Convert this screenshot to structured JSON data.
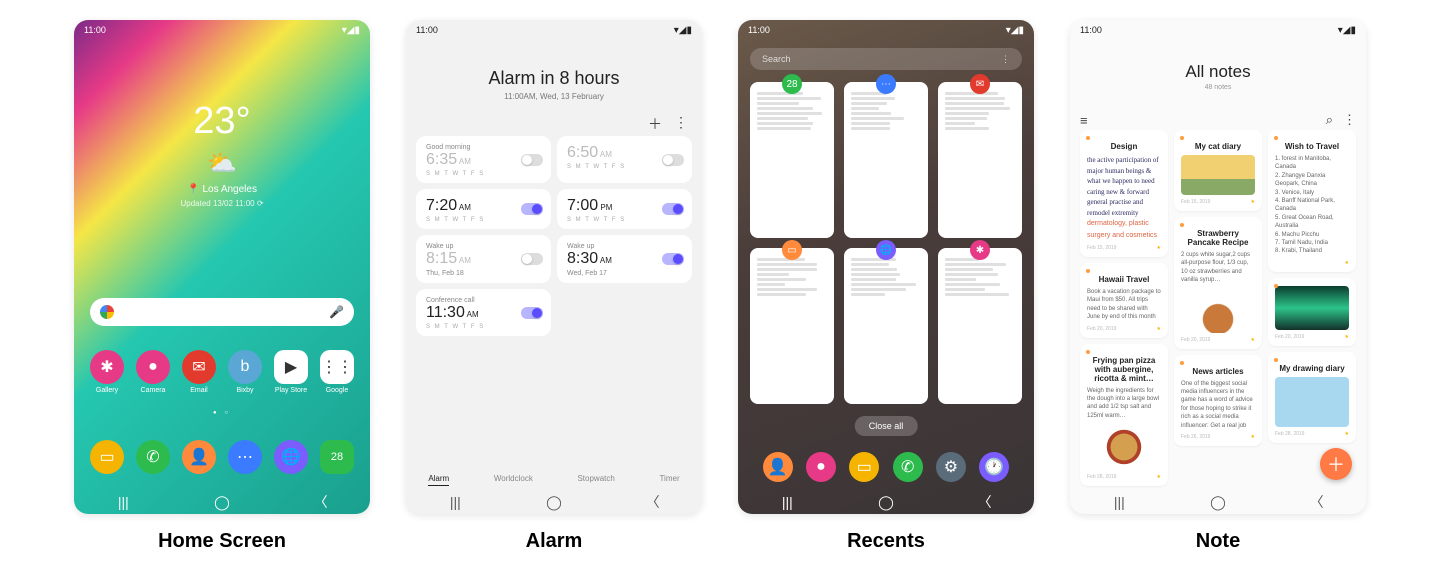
{
  "captions": {
    "home": "Home Screen",
    "alarm": "Alarm",
    "recents": "Recents",
    "note": "Note"
  },
  "status_time": "11:00",
  "home": {
    "temp": "23°",
    "location": "Los Angeles",
    "updated": "Updated 13/02 11:00 ⟳",
    "apps": [
      {
        "label": "Gallery",
        "bg": "#e73a86",
        "glyph": "✱"
      },
      {
        "label": "Camera",
        "bg": "#e73a86",
        "glyph": "●"
      },
      {
        "label": "Email",
        "bg": "#e23b2e",
        "glyph": "✉"
      },
      {
        "label": "Bixby",
        "bg": "#5aa7d6",
        "glyph": "b"
      },
      {
        "label": "Play Store",
        "bg": "#fff",
        "glyph": "▶"
      },
      {
        "label": "Google",
        "bg": "#fff",
        "glyph": "⋮⋮"
      }
    ],
    "dock": [
      {
        "bg": "#f5b400",
        "glyph": "▭"
      },
      {
        "bg": "#2dbb4e",
        "glyph": "✆"
      },
      {
        "bg": "#ff8a3c",
        "glyph": "👤"
      },
      {
        "bg": "#3a7bff",
        "glyph": "⋯"
      },
      {
        "bg": "#7a5cff",
        "glyph": "🌐"
      },
      {
        "bg": "#2dbb4e",
        "glyph": "28"
      }
    ]
  },
  "alarm": {
    "title": "Alarm in 8 hours",
    "subtitle": "11:00AM, Wed, 13 February",
    "days": "S M T W T F S",
    "tabs": [
      "Alarm",
      "Worldclock",
      "Stopwatch",
      "Timer"
    ],
    "cards": [
      {
        "label": "Good morning",
        "time": "6:35",
        "ampm": "AM",
        "mode": "days",
        "on": false
      },
      {
        "label": "",
        "time": "6:50",
        "ampm": "AM",
        "mode": "days",
        "on": false
      },
      {
        "label": "",
        "time": "7:20",
        "ampm": "AM",
        "mode": "days",
        "on": true
      },
      {
        "label": "",
        "time": "7:00",
        "ampm": "PM",
        "mode": "days",
        "on": true
      },
      {
        "label": "Wake up",
        "time": "8:15",
        "ampm": "AM",
        "mode": "date",
        "date": "Thu, Feb 18",
        "on": false
      },
      {
        "label": "Wake up",
        "time": "8:30",
        "ampm": "AM",
        "mode": "date",
        "date": "Wed, Feb 17",
        "on": true
      },
      {
        "label": "Conference call",
        "time": "11:30",
        "ampm": "AM",
        "mode": "days",
        "on": true
      }
    ]
  },
  "recents": {
    "search": "Search",
    "close_all": "Close all",
    "cards": [
      {
        "bg": "#2dbb4e",
        "glyph": "28"
      },
      {
        "bg": "#3a7bff",
        "glyph": "⋯"
      },
      {
        "bg": "#e23b2e",
        "glyph": "✉"
      },
      {
        "bg": "#ff8a3c",
        "glyph": "▭"
      },
      {
        "bg": "#7a5cff",
        "glyph": "🌐"
      },
      {
        "bg": "#e73a86",
        "glyph": "✱"
      }
    ],
    "dock": [
      {
        "bg": "#ff8a3c",
        "glyph": "👤"
      },
      {
        "bg": "#e73a86",
        "glyph": "●"
      },
      {
        "bg": "#f5b400",
        "glyph": "▭"
      },
      {
        "bg": "#2dbb4e",
        "glyph": "✆"
      },
      {
        "bg": "#5a6b7a",
        "glyph": "⚙"
      },
      {
        "bg": "#7a5cff",
        "glyph": "🕐"
      }
    ]
  },
  "note": {
    "title": "All notes",
    "subtitle": "48 notes",
    "col1": [
      {
        "title": "Design",
        "type": "hand",
        "body": "the active participation of major human beings & what we happen to need caring new & forward general practise and remodel extremity",
        "red": "dermatology, plastic surgery and cosmetics",
        "date": "Feb 15, 2019"
      },
      {
        "title": "Hawaii Travel",
        "type": "text",
        "body": "Book a vacation  package to Maui from $50. All trips need to be shared with June by end of this month",
        "date": "Feb 20, 2019"
      },
      {
        "title": "Frying pan pizza with aubergine, ricotta & mint…",
        "type": "pizza",
        "body": "Weigh the ingredients for the dough into a large bowl and add 1/2 tsp salt and 125ml warm…",
        "date": "Feb 28, 2019"
      }
    ],
    "col2": [
      {
        "title": "My cat diary",
        "type": "cat",
        "date": "Feb 15, 2019"
      },
      {
        "title": "Strawberry Pancake Recipe",
        "type": "pancake",
        "body": "2 cups white sugar,2 cups all-purpose flour, 1/3 cup, 10 oz strawberries and vanilla syrup…",
        "date": "Feb 20, 2019"
      },
      {
        "title": "News articles",
        "type": "text",
        "body": "One of the biggest social media influencers in the game has a word of advice for those hoping to strike it rich as a social media influencer: Get a real job",
        "date": "Feb 26, 2019"
      }
    ],
    "col3": [
      {
        "title": "Wish to Travel",
        "type": "list",
        "body": "1. forest in Manitoba, Canada\n2. Zhangye Danxia Geopark, China\n3. Venice, Italy\n4. Banff National Park, Canada\n5. Great Ocean Road, Australia\n6. Machu Picchu\n7. Tamil Nadu, India\n8. Krabi, Thailand",
        "date": ""
      },
      {
        "title": "",
        "type": "aurora",
        "date": "Feb 20, 2019"
      },
      {
        "title": "My drawing diary",
        "type": "drawing",
        "date": "Feb 28, 2019"
      }
    ]
  }
}
